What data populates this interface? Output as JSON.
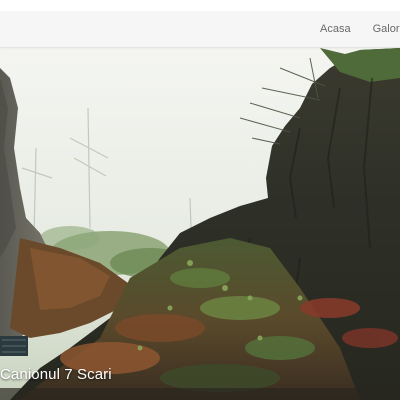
{
  "nav": {
    "items": [
      {
        "label": "Acasa"
      },
      {
        "label": "Galor"
      }
    ]
  },
  "hero": {
    "caption": "Canionul 7 Scari",
    "image": "canyon-photo"
  },
  "colors": {
    "navbar_bg": "#f6f6f6",
    "nav_text": "#6a6a6a",
    "caption_text": "#ffffff"
  }
}
